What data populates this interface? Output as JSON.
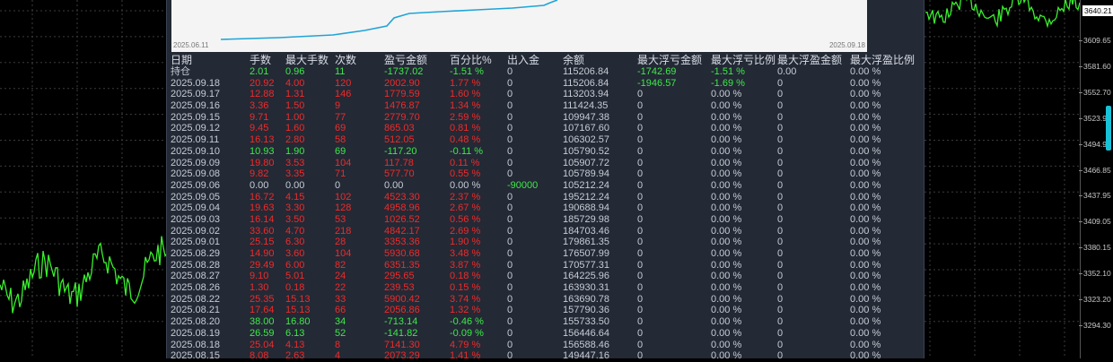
{
  "colors": {
    "background": "#000000",
    "panel": "#232935",
    "price_line": "#39f02c",
    "profit": "#3fe84a",
    "loss": "#ee2b2b",
    "equity_curve": "#1ea4d8"
  },
  "mini_chart": {
    "start_date": "2025.06.11",
    "end_date": "2025.09.18"
  },
  "price_axis": {
    "current_price": "3640.21",
    "ticks": [
      "3609.65",
      "3581.60",
      "3552.70",
      "3523.9",
      "3494.9",
      "3466.85",
      "3437.95",
      "3409.05",
      "3380.15",
      "3352.10",
      "3323.20",
      "3294.30"
    ]
  },
  "table": {
    "headers": [
      "日期",
      "手数",
      "最大手数",
      "次数",
      "盈亏金额",
      "百分比%",
      "出入金",
      "余额",
      "最大浮亏金额",
      "最大浮亏比例",
      "最大浮盈金额",
      "最大浮盈比例"
    ],
    "holding": [
      "持仓",
      "2.01",
      "0.96",
      "11",
      "-1737.02",
      "-1.51 %",
      "0",
      "115206.84",
      "-1742.69",
      "-1.51 %",
      "0.00",
      "0.00 %"
    ],
    "rows": [
      [
        "2025.09.18",
        "20.92",
        "4.00",
        "120",
        "2002.90",
        "1.77 %",
        "0",
        "115206.84",
        "-1946.57",
        "-1.69 %",
        "0",
        "0.00 %"
      ],
      [
        "2025.09.17",
        "12.88",
        "1.31",
        "146",
        "1779.59",
        "1.60 %",
        "0",
        "113203.94",
        "0",
        "0.00 %",
        "0",
        "0.00 %"
      ],
      [
        "2025.09.16",
        "3.36",
        "1.50",
        "9",
        "1476.87",
        "1.34 %",
        "0",
        "111424.35",
        "0",
        "0.00 %",
        "0",
        "0.00 %"
      ],
      [
        "2025.09.15",
        "9.71",
        "1.00",
        "77",
        "2779.70",
        "2.59 %",
        "0",
        "109947.38",
        "0",
        "0.00 %",
        "0",
        "0.00 %"
      ],
      [
        "2025.09.12",
        "9.45",
        "1.60",
        "69",
        "865.03",
        "0.81 %",
        "0",
        "107167.60",
        "0",
        "0.00 %",
        "0",
        "0.00 %"
      ],
      [
        "2025.09.11",
        "16.13",
        "2.80",
        "58",
        "512.05",
        "0.48 %",
        "0",
        "106302.57",
        "0",
        "0.00 %",
        "0",
        "0.00 %"
      ],
      [
        "2025.09.10",
        "10.93",
        "1.90",
        "69",
        "-117.20",
        "-0.11 %",
        "0",
        "105790.52",
        "0",
        "0.00 %",
        "0",
        "0.00 %"
      ],
      [
        "2025.09.09",
        "19.80",
        "3.53",
        "104",
        "117.78",
        "0.11 %",
        "0",
        "105907.72",
        "0",
        "0.00 %",
        "0",
        "0.00 %"
      ],
      [
        "2025.09.08",
        "9.82",
        "3.35",
        "71",
        "577.70",
        "0.55 %",
        "0",
        "105789.94",
        "0",
        "0.00 %",
        "0",
        "0.00 %"
      ],
      [
        "2025.09.06",
        "0.00",
        "0.00",
        "0",
        "0.00",
        "0.00 %",
        "-90000",
        "105212.24",
        "0",
        "0.00 %",
        "0",
        "0.00 %"
      ],
      [
        "2025.09.05",
        "16.72",
        "4.15",
        "102",
        "4523.30",
        "2.37 %",
        "0",
        "195212.24",
        "0",
        "0.00 %",
        "0",
        "0.00 %"
      ],
      [
        "2025.09.04",
        "19.63",
        "3.30",
        "128",
        "4958.96",
        "2.67 %",
        "0",
        "190688.94",
        "0",
        "0.00 %",
        "0",
        "0.00 %"
      ],
      [
        "2025.09.03",
        "16.14",
        "3.50",
        "53",
        "1026.52",
        "0.56 %",
        "0",
        "185729.98",
        "0",
        "0.00 %",
        "0",
        "0.00 %"
      ],
      [
        "2025.09.02",
        "33.60",
        "4.70",
        "218",
        "4842.17",
        "2.69 %",
        "0",
        "184703.46",
        "0",
        "0.00 %",
        "0",
        "0.00 %"
      ],
      [
        "2025.09.01",
        "25.15",
        "6.30",
        "28",
        "3353.36",
        "1.90 %",
        "0",
        "179861.35",
        "0",
        "0.00 %",
        "0",
        "0.00 %"
      ],
      [
        "2025.08.29",
        "14.90",
        "3.60",
        "104",
        "5930.68",
        "3.48 %",
        "0",
        "176507.99",
        "0",
        "0.00 %",
        "0",
        "0.00 %"
      ],
      [
        "2025.08.28",
        "29.49",
        "6.00",
        "82",
        "6351.35",
        "3.87 %",
        "0",
        "170577.31",
        "0",
        "0.00 %",
        "0",
        "0.00 %"
      ],
      [
        "2025.08.27",
        "9.10",
        "5.01",
        "24",
        "295.65",
        "0.18 %",
        "0",
        "164225.96",
        "0",
        "0.00 %",
        "0",
        "0.00 %"
      ],
      [
        "2025.08.26",
        "1.30",
        "0.18",
        "22",
        "239.53",
        "0.15 %",
        "0",
        "163930.31",
        "0",
        "0.00 %",
        "0",
        "0.00 %"
      ],
      [
        "2025.08.22",
        "25.35",
        "15.13",
        "33",
        "5900.42",
        "3.74 %",
        "0",
        "163690.78",
        "0",
        "0.00 %",
        "0",
        "0.00 %"
      ],
      [
        "2025.08.21",
        "17.64",
        "15.13",
        "66",
        "2056.86",
        "1.32 %",
        "0",
        "157790.36",
        "0",
        "0.00 %",
        "0",
        "0.00 %"
      ],
      [
        "2025.08.20",
        "38.00",
        "16.80",
        "34",
        "-713.14",
        "-0.46 %",
        "0",
        "155733.50",
        "0",
        "0.00 %",
        "0",
        "0.00 %"
      ],
      [
        "2025.08.19",
        "26.59",
        "6.13",
        "52",
        "-141.82",
        "-0.09 %",
        "0",
        "156446.64",
        "0",
        "0.00 %",
        "0",
        "0.00 %"
      ],
      [
        "2025.08.18",
        "25.04",
        "4.13",
        "8",
        "7141.30",
        "4.79 %",
        "0",
        "156588.46",
        "0",
        "0.00 %",
        "0",
        "0.00 %"
      ],
      [
        "2025.08.15",
        "8.08",
        "2.63",
        "4",
        "2073.29",
        "1.41 %",
        "0",
        "149447.16",
        "0",
        "0.00 %",
        "0",
        "0.00 %"
      ]
    ]
  }
}
